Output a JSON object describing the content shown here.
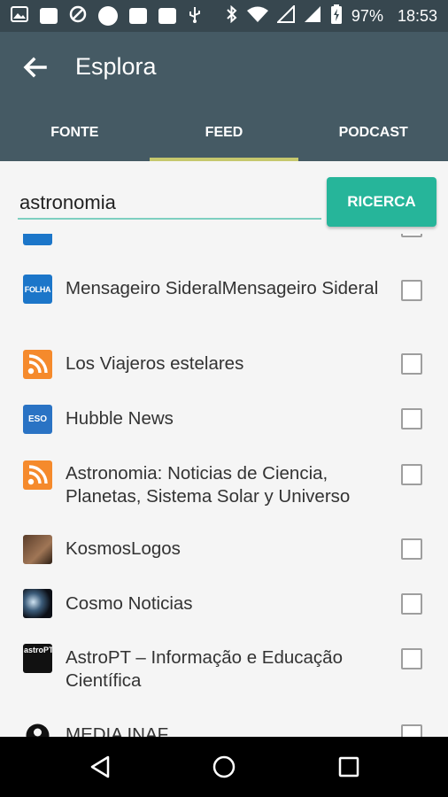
{
  "status_bar": {
    "battery": "97%",
    "time": "18:53"
  },
  "appbar": {
    "title": "Esplora"
  },
  "tabs": [
    {
      "label": "FONTE"
    },
    {
      "label": "FEED"
    },
    {
      "label": "PODCAST"
    }
  ],
  "search": {
    "value": "astronomia",
    "button_label": "RICERCA"
  },
  "feeds": [
    {
      "title": "Mensageiro SideralMensageiro Sideral",
      "icon": "folha-icon",
      "checked": false
    },
    {
      "title": "Los Viajeros estelares",
      "icon": "rss-icon",
      "checked": false
    },
    {
      "title": "Hubble News",
      "icon": "eso-icon",
      "checked": false
    },
    {
      "title": "Astronomia: Noticias de Ciencia, Planetas, Sistema Solar y Universo",
      "icon": "rss-icon",
      "checked": false
    },
    {
      "title": "KosmosLogos",
      "icon": "kosmoslogos-icon",
      "checked": false
    },
    {
      "title": "Cosmo Noticias",
      "icon": "cosmo-icon",
      "checked": false
    },
    {
      "title": "AstroPT – Informação e Educação Científica",
      "icon": "astropt-icon",
      "checked": false
    },
    {
      "title": "MEDIA INAF",
      "icon": "inaf-icon",
      "checked": false
    }
  ],
  "icon_text": {
    "folha": "FOLHA",
    "eso": "ESO",
    "astropt": "astroPT"
  },
  "colors": {
    "status_bar": "#37474f",
    "appbar": "#455a64",
    "tab_indicator": "#c6c86d",
    "accent": "#26b59a",
    "input_underline": "#7ecfc0"
  }
}
